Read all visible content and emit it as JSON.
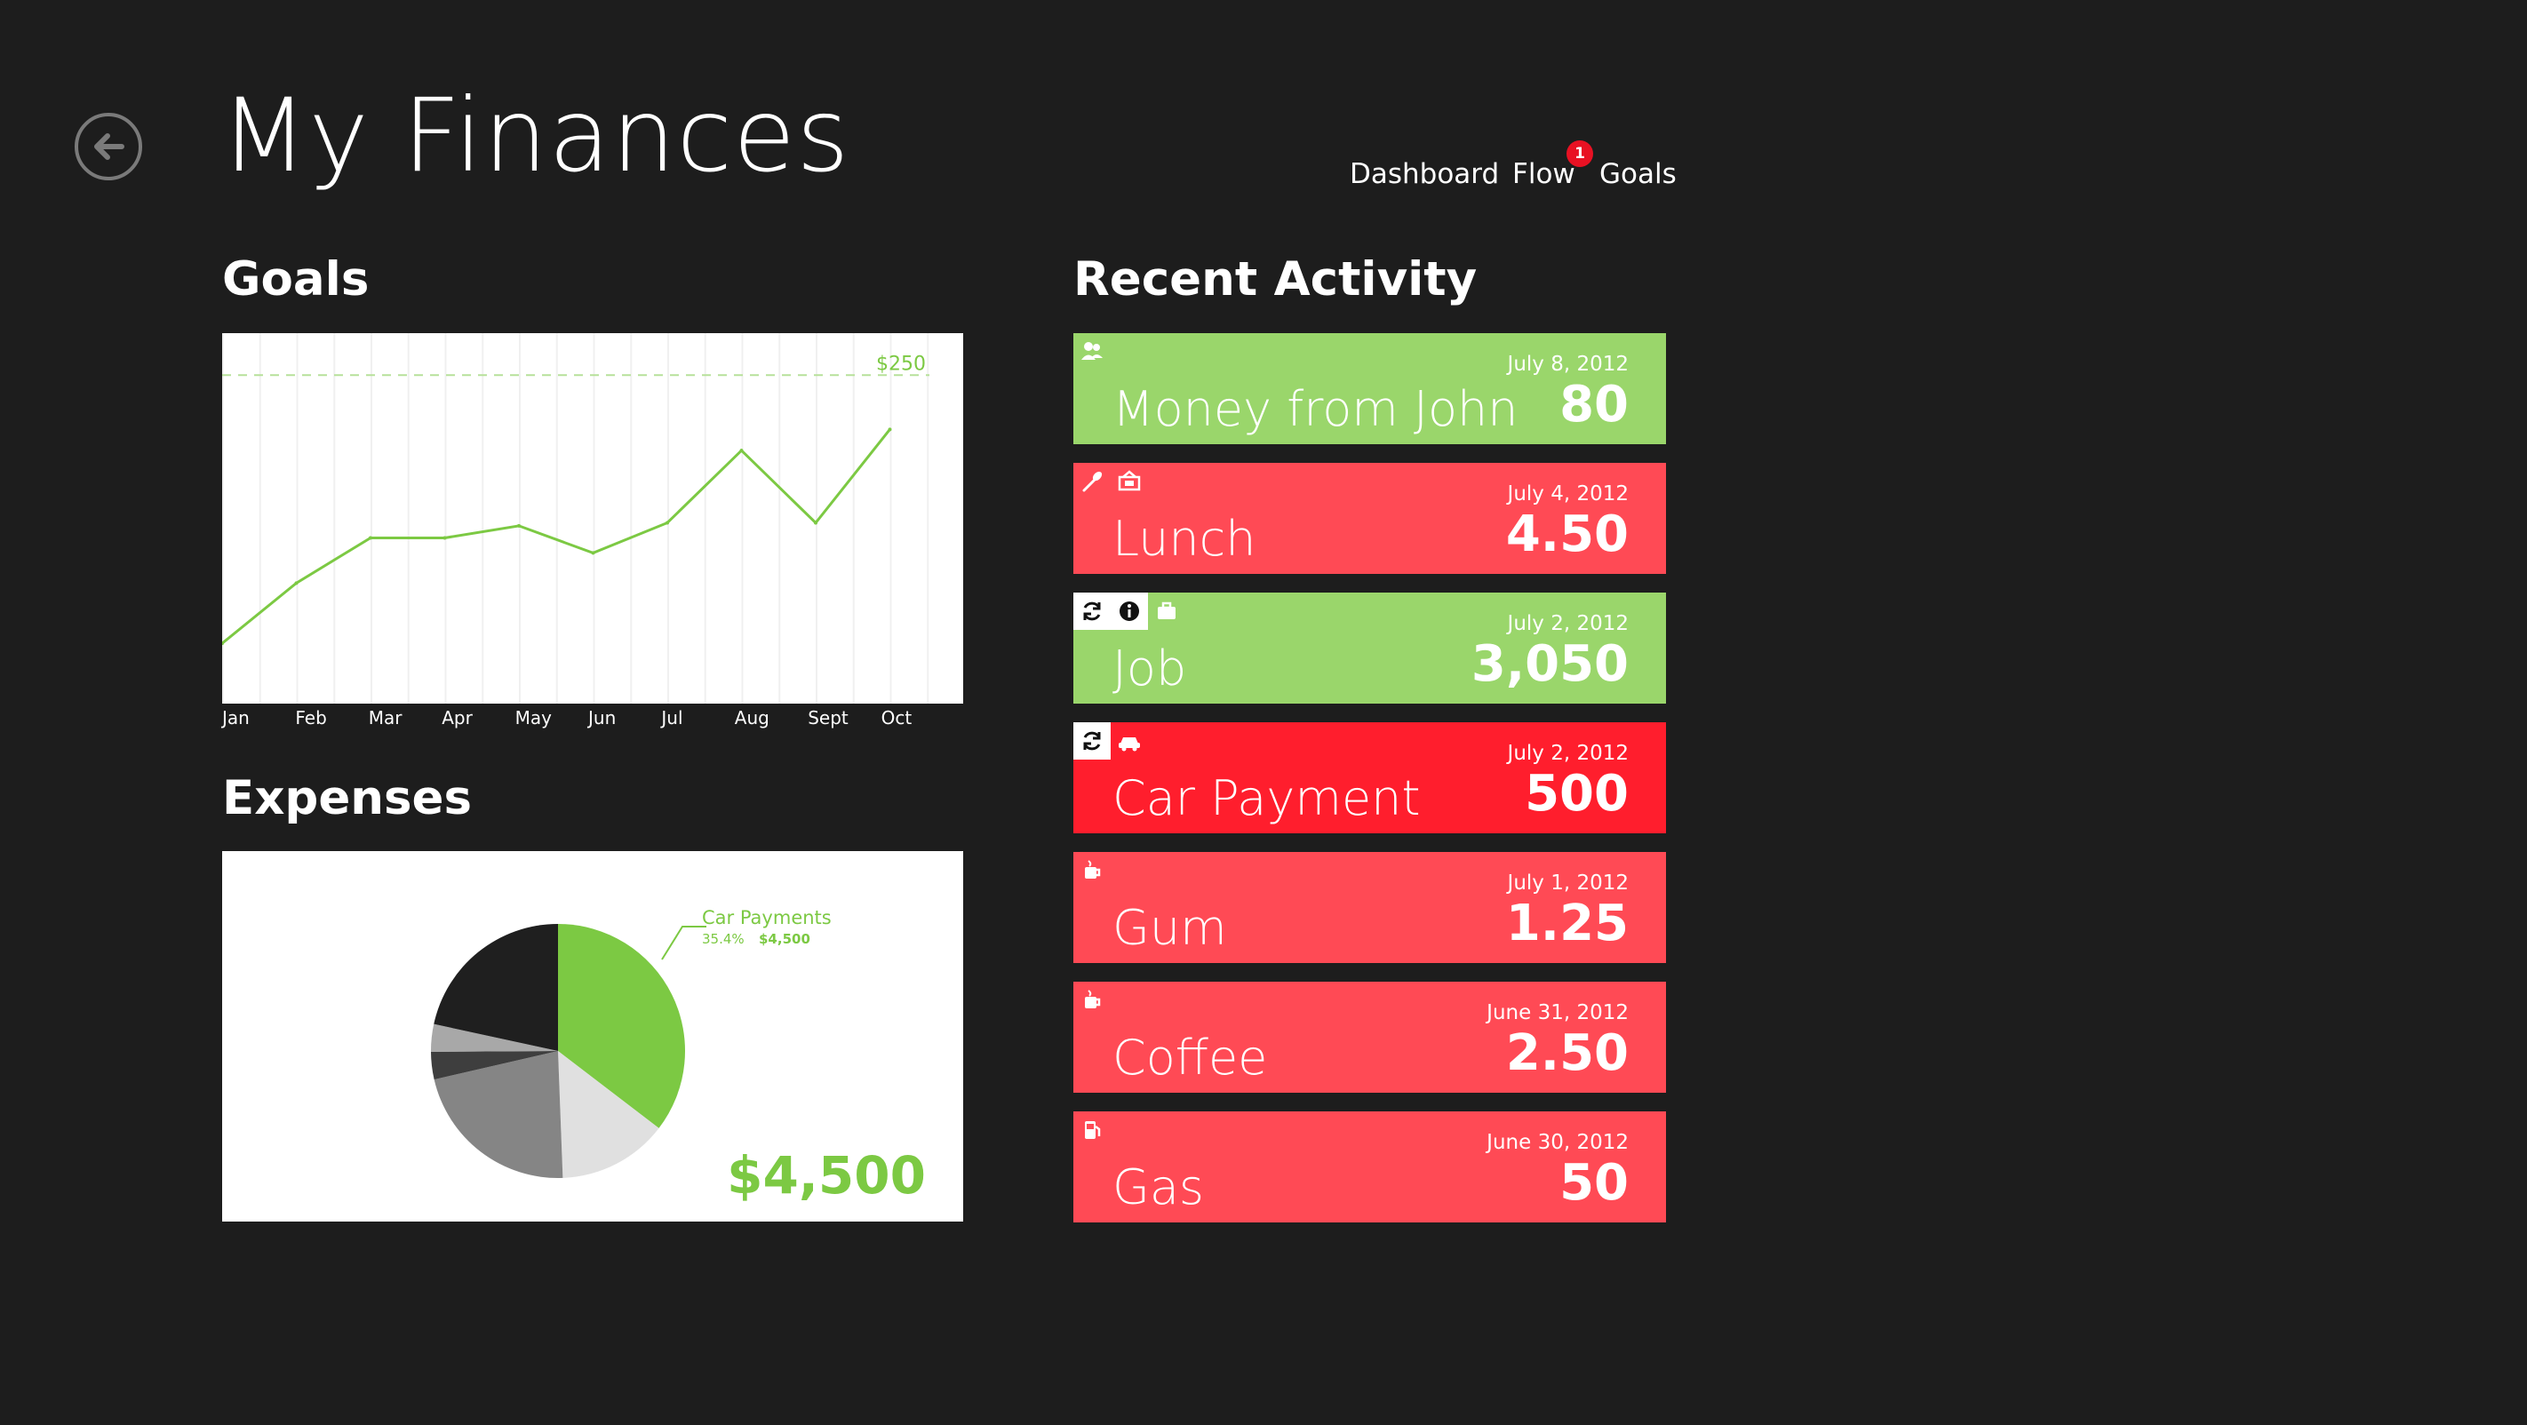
{
  "header": {
    "title": "My Finances",
    "back_icon": "arrow-left-icon",
    "nav": [
      {
        "label": "Dashboard"
      },
      {
        "label": "Flow",
        "badge": "1"
      },
      {
        "label": "Goals"
      }
    ]
  },
  "goals": {
    "section_title": "Goals",
    "chart_data": {
      "type": "line",
      "title": "",
      "xlabel": "",
      "ylabel": "",
      "categories": [
        "Jan",
        "",
        "Feb",
        "",
        "Mar",
        "",
        "Apr",
        "",
        "May",
        "",
        "Jun",
        "",
        "Jul",
        "",
        "Aug",
        "",
        "Sept",
        "",
        "Oct",
        ""
      ],
      "tick_labels": [
        "Jan",
        "Feb",
        "Mar",
        "Apr",
        "May",
        "Jun",
        "Jul",
        "Aug",
        "Sept",
        "Oct"
      ],
      "values": [
        40,
        80,
        110,
        110,
        118,
        100,
        120,
        168,
        120,
        182
      ],
      "target_label": "$250",
      "target_value": 218,
      "ylim": [
        0,
        240
      ],
      "grid": true,
      "line_color": "#7cc943"
    }
  },
  "expenses": {
    "section_title": "Expenses",
    "total": "$4,500",
    "chart_data": {
      "type": "pie",
      "slices": [
        {
          "name": "Car Payments",
          "percent": 35.4,
          "amount": "$4,500",
          "color": "#7cc943"
        },
        {
          "name": "",
          "percent": 14.0,
          "color": "#e0e0e0"
        },
        {
          "name": "",
          "percent": 22.0,
          "color": "#858585"
        },
        {
          "name": "",
          "percent": 3.5,
          "color": "#3e3e3e"
        },
        {
          "name": "",
          "percent": 3.5,
          "color": "#a8a8a8"
        },
        {
          "name": "",
          "percent": 21.6,
          "color": "#1f1f1f"
        }
      ],
      "callout": {
        "label": "Car Payments",
        "percent_text": "35.4%",
        "amount_text": "$4,500"
      }
    }
  },
  "activity": {
    "section_title": "Recent Activity",
    "items": [
      {
        "label": "Money from John",
        "date": "July 8, 2012",
        "amount": "80",
        "color": "#9ad66b",
        "icons": [
          {
            "name": "people-icon",
            "boxed": false
          }
        ]
      },
      {
        "label": "Lunch",
        "date": "July 4, 2012",
        "amount": "4.50",
        "color": "#ff4a55",
        "icons": [
          {
            "name": "utensils-icon",
            "boxed": false
          },
          {
            "name": "receipt-icon",
            "boxed": false
          }
        ]
      },
      {
        "label": "Job",
        "date": "July 2, 2012",
        "amount": "3,050",
        "color": "#9ad66b",
        "icons": [
          {
            "name": "refresh-icon",
            "boxed": true
          },
          {
            "name": "info-icon",
            "boxed": true
          },
          {
            "name": "briefcase-icon",
            "boxed": false
          }
        ]
      },
      {
        "label": "Car Payment",
        "date": "July 2, 2012",
        "amount": "500",
        "color": "#ff1e2d",
        "icons": [
          {
            "name": "refresh-icon",
            "boxed": true
          },
          {
            "name": "car-icon",
            "boxed": false
          }
        ]
      },
      {
        "label": "Gum",
        "date": "July 1, 2012",
        "amount": "1.25",
        "color": "#ff4a55",
        "icons": [
          {
            "name": "cup-icon",
            "boxed": false
          }
        ]
      },
      {
        "label": "Coffee",
        "date": "June 31, 2012",
        "amount": "2.50",
        "color": "#ff4a55",
        "icons": [
          {
            "name": "cup-icon",
            "boxed": false
          }
        ]
      },
      {
        "label": "Gas",
        "date": "June 30, 2012",
        "amount": "50",
        "color": "#ff4a55",
        "icons": [
          {
            "name": "fuel-icon",
            "boxed": false
          }
        ]
      }
    ]
  }
}
